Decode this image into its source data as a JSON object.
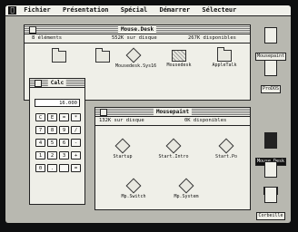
{
  "menubar": {
    "apple": "",
    "items": [
      "Fichier",
      "Présentation",
      "Spécial",
      "Démarrer",
      "Sélecteur"
    ]
  },
  "main_window": {
    "title": "Mouse.Desk",
    "info": {
      "items": "8 éléments",
      "used": "552K sur disque",
      "free": "267K disponibles"
    },
    "icons": [
      "Mousedesk.Sys16",
      "Mousedesk",
      "AppleTalk"
    ]
  },
  "sub_window": {
    "title": "Mousepaint",
    "info": {
      "used": "132K sur disque",
      "free": "0K disponibles"
    },
    "icons": [
      "Startup",
      "Start.Intro",
      "Start.Po",
      "Mp.Switch",
      "Mp.System"
    ]
  },
  "calculator": {
    "title": "Calc",
    "display": "16.000",
    "keys": [
      "C",
      "E",
      "=",
      "*",
      "7",
      "8",
      "9",
      "/",
      "4",
      "5",
      "6",
      "-",
      "1",
      "2",
      "3",
      "+",
      "0",
      ".",
      "",
      "="
    ]
  },
  "desktop_icons": [
    {
      "label": "Mousepaint",
      "selected": false
    },
    {
      "label": "ProDOS",
      "selected": false
    },
    {
      "label": "Mouse.Desk",
      "selected": true
    },
    {
      "label": "Sys.",
      "selected": false
    },
    {
      "label": "Corbeille",
      "selected": false
    }
  ]
}
